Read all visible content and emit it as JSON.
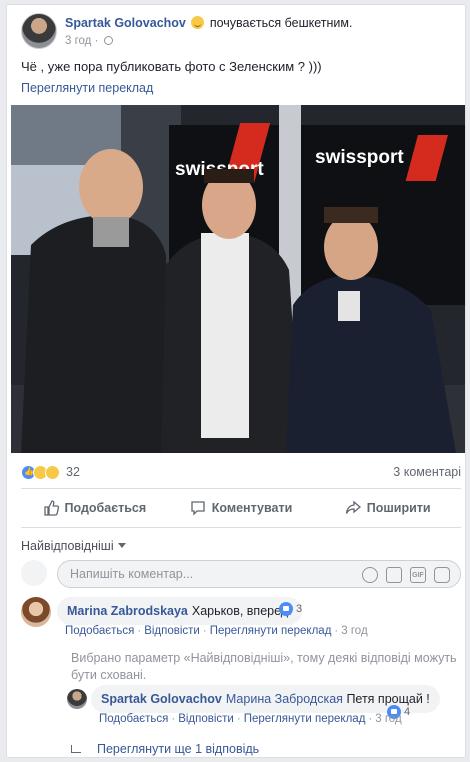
{
  "post": {
    "author": "Spartak Golovachov",
    "feeling": "почувається бешкетним.",
    "time": "3 год",
    "separator": "·",
    "text": "Чё , уже пора публиковать фото с Зеленским ? )))",
    "translate_link": "Переглянути переклад",
    "photo": {
      "sign_text_1": "swissport",
      "sign_text_2": "swissport"
    }
  },
  "stats": {
    "reaction_count": "32",
    "comments_count": "3 коментарі",
    "reaction_icons": [
      "like-icon",
      "wow-icon",
      "sad-icon"
    ]
  },
  "actions": {
    "like": "Подобається",
    "comment": "Коментувати",
    "share": "Поширити"
  },
  "sort_label": "Найвідповідніші",
  "composer": {
    "placeholder": "Напишіть коментар...",
    "icons": [
      "emoji-icon",
      "camera-icon",
      "gif-icon",
      "sticker-icon"
    ],
    "gif_label": "GIF"
  },
  "comments": [
    {
      "author": "Marina Zabrodskaya",
      "text": "Харьков, вперед!",
      "likes": "3",
      "actions": [
        "Подобається",
        "Відповісти",
        "Переглянути переклад"
      ],
      "time": "3 год"
    }
  ],
  "note": "Вибрано параметр «Найвідповідніші», тому деякі відповіді можуть бути сховані.",
  "reply": {
    "author": "Spartak Golovachov",
    "mention": "Марина Забродская",
    "text": "Петя прощай !",
    "likes": "4",
    "actions": [
      "Подобається",
      "Відповісти",
      "Переглянути переклад"
    ],
    "time": "3 год"
  },
  "more_replies": "Переглянути ще 1 відповідь",
  "colors": {
    "link": "#365899",
    "muted": "#90949c",
    "like_blue": "#4d8cf5",
    "swissport_red": "#d52b1e"
  }
}
